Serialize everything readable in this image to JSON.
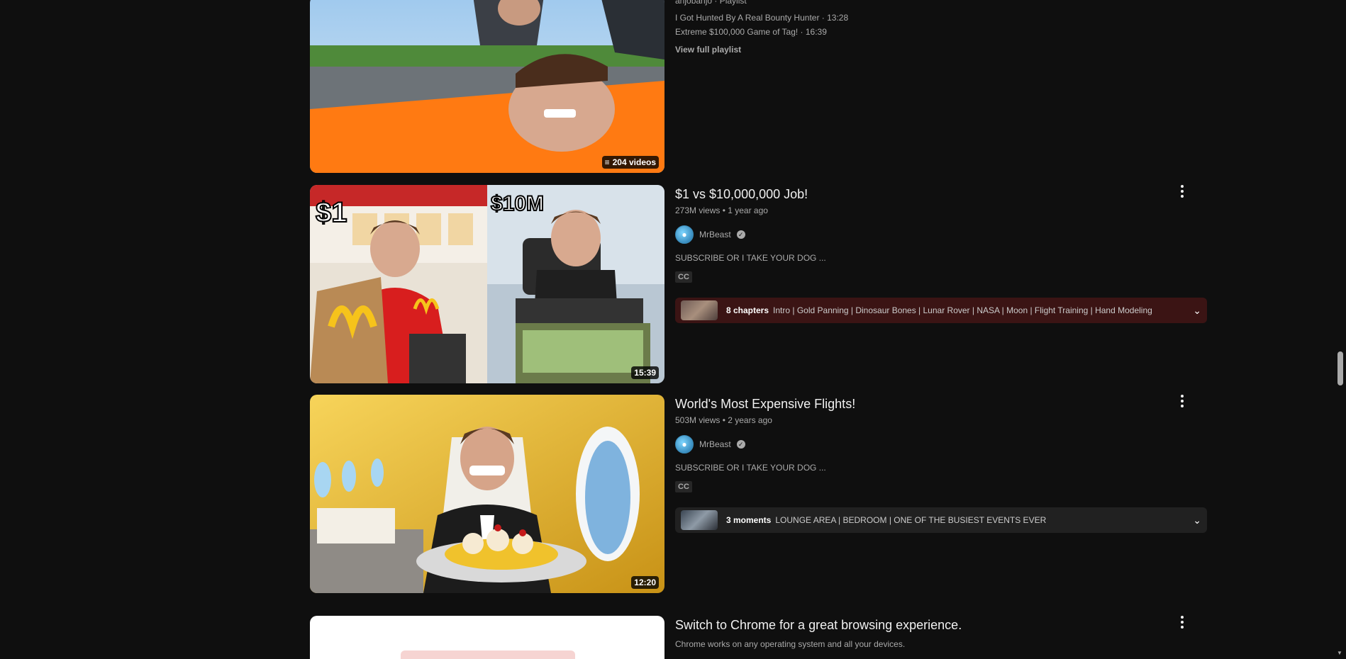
{
  "playlist": {
    "byline": "anjobanjo · Playlist",
    "items": [
      "I Got Hunted By A Real Bounty Hunter · 13:28",
      "Extreme $100,000 Game of Tag! · 16:39"
    ],
    "view_full": "View full playlist",
    "badge": "204 videos"
  },
  "videos": [
    {
      "title": "$1 vs $10,000,000 Job!",
      "meta": "273M views • 1 year ago",
      "channel": "MrBeast",
      "description": "SUBSCRIBE OR I TAKE YOUR DOG ...",
      "cc": "CC",
      "duration": "15:39",
      "thumb_text_left": "$1",
      "thumb_text_right": "$10M",
      "chapters_count": "8 chapters",
      "chapters_list": "Intro | Gold Panning | Dinosaur Bones | Lunar Rover | NASA | Moon | Flight Training | Hand Modeling",
      "chapters_bg": "#3b1414"
    },
    {
      "title": "World's Most Expensive Flights!",
      "meta": "503M views • 2 years ago",
      "channel": "MrBeast",
      "description": "SUBSCRIBE OR I TAKE YOUR DOG ...",
      "cc": "CC",
      "duration": "12:20",
      "chapters_count": "3 moments",
      "chapters_list": "LOUNGE AREA | BEDROOM | ONE OF THE BUSIEST EVENTS EVER",
      "chapters_bg": "#212121"
    }
  ],
  "ad": {
    "title": "Switch to Chrome for a great browsing experience.",
    "subtitle": "Chrome works on any operating system and all your devices."
  },
  "icons": {
    "playlist": "playlist-icon",
    "verified": "verified-check-icon",
    "more": "more-vert-icon",
    "expand": "chevron-down-icon"
  }
}
